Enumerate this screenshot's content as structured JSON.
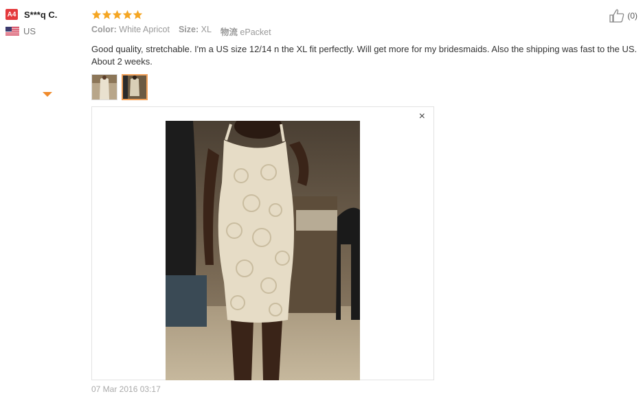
{
  "reviewer": {
    "badge": "A4",
    "name": "S***q C.",
    "country": "US",
    "flag_icon": "us-flag-icon"
  },
  "rating": {
    "stars": 5,
    "max": 5,
    "color": "#f5a623"
  },
  "attributes": [
    {
      "key": "Color:",
      "value": "White Apricot"
    },
    {
      "key": "Size:",
      "value": "XL"
    },
    {
      "key": "物流",
      "value": "ePacket"
    }
  ],
  "review_text": "Good quality, stretchable. I'm a US size 12/14 n the XL fit perfectly. Will get more for my bridesmaids. Also the shipping was fast to the US. About 2 weeks.",
  "helpful": {
    "count": "(0)",
    "icon": "thumbs-up-icon"
  },
  "viewer": {
    "close_label": "×"
  },
  "date": "07 Mar 2016 03:17",
  "colors": {
    "accent": "#f08a2b",
    "badge": "#e4393c"
  }
}
